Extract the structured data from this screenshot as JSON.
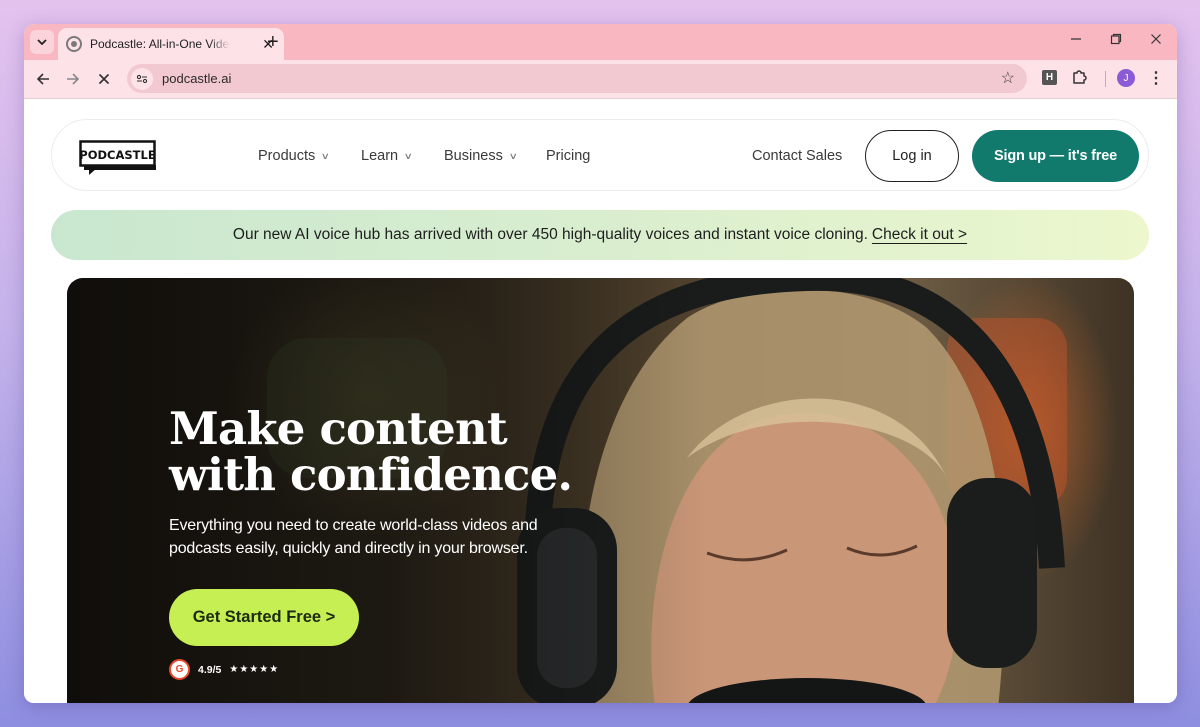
{
  "browser": {
    "tab_title": "Podcastle: All-in-One Video and Podcast Platform",
    "tab_close": "✕",
    "new_tab": "+",
    "url": "podcastle.ai",
    "profile_initial": "J",
    "extension_label": "H",
    "icons": [
      "tab-search-icon",
      "back-icon",
      "forward-icon",
      "stop-icon",
      "site-info-icon",
      "bookmark-star-icon",
      "extensions-icon",
      "menu-icon",
      "minimize-icon",
      "restore-icon",
      "close-icon"
    ]
  },
  "nav": {
    "logo_text": "PODCASTLE",
    "items": [
      {
        "label": "Products",
        "has_dropdown": true
      },
      {
        "label": "Learn",
        "has_dropdown": true
      },
      {
        "label": "Business",
        "has_dropdown": true
      },
      {
        "label": "Pricing",
        "has_dropdown": false
      }
    ],
    "contact_sales": "Contact Sales",
    "login": "Log in",
    "signup": "Sign up — it's free"
  },
  "banner": {
    "text": "Our new AI voice hub has arrived with over 450 high-quality voices and instant voice cloning.",
    "link": "Check it out >"
  },
  "hero": {
    "title_line1": "Make content",
    "title_line2": "with confidence.",
    "subtitle": "Everything you need to create world-class videos and podcasts easily, quickly and directly in your browser.",
    "cta": "Get Started Free >",
    "rating_badge": "G",
    "rating_score": "4.9/5",
    "rating_stars": "★★★★★"
  },
  "colors": {
    "brand_teal": "#117a6d",
    "cta_lime": "#c6ef54",
    "tab_strip": "#f9b7c2"
  }
}
